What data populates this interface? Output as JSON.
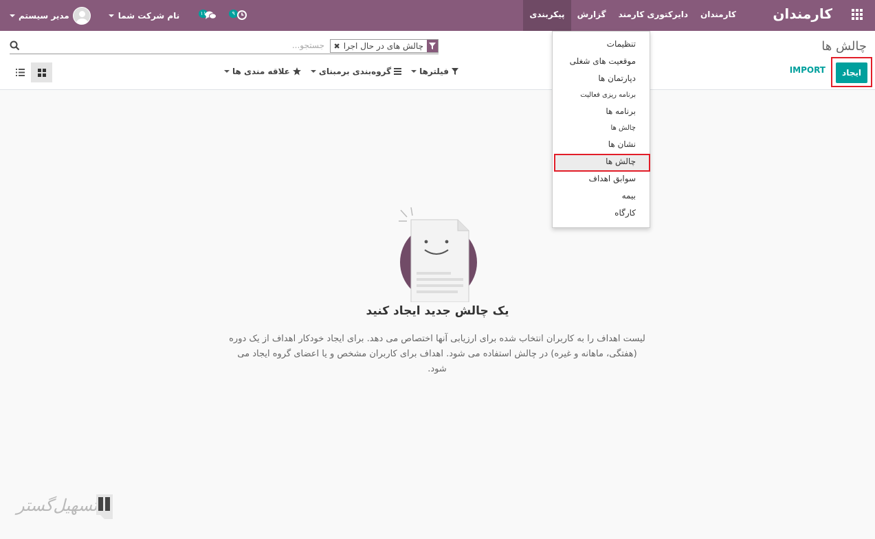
{
  "navbar": {
    "brand": "کارمندان",
    "menu": [
      "کارمندان",
      "دایرکتوری کارمند",
      "گزارش",
      "پیکربندی"
    ],
    "user_name": "مدیر سیستم",
    "company": "نام شرکت شما",
    "activity_badge": "۹",
    "messages_badge": "۱۱"
  },
  "control_panel": {
    "breadcrumb": "چالش ها",
    "create_label": "ایجاد",
    "import_label": "IMPORT",
    "search_facet": "چالش های در حال اجرا",
    "search_placeholder": "جستجو...",
    "filters_label": "فیلترها",
    "groupby_label": "گروه‌بندی برمبنای",
    "favorites_label": "علاقه مندی ها"
  },
  "dropdown": {
    "items": [
      {
        "label": "تنظیمات",
        "small": false
      },
      {
        "label": "موقعیت های شغلی",
        "small": false
      },
      {
        "label": "دپارتمان ها",
        "small": false
      },
      {
        "label": "برنامه ریزی فعالیت",
        "small": true
      },
      {
        "label": "برنامه ها",
        "small": false
      },
      {
        "label": "چالش ها",
        "small": true
      },
      {
        "label": "نشان ها",
        "small": false
      },
      {
        "label": "چالش ها",
        "small": false
      },
      {
        "label": "سوابق اهداف",
        "small": false
      },
      {
        "label": "بیمه",
        "small": false
      },
      {
        "label": "کارگاه",
        "small": false
      }
    ]
  },
  "empty_state": {
    "title": "یک چالش جدید ایجاد کنید",
    "description": "لیست اهداف را به کاربران انتخاب شده برای ارزیابی آنها اختصاص می دهد. برای ایجاد خودکار اهداف از یک دوره (هفتگی، ماهانه و غیره) در چالش استفاده می شود. اهداف برای کاربران مشخص و یا اعضای گروه ایجاد می شود."
  },
  "watermark": {
    "text": "تسهیل‌گستر"
  },
  "colors": {
    "navbar": "#875a7b",
    "accent": "#00a09d",
    "highlight": "#e21d28"
  }
}
